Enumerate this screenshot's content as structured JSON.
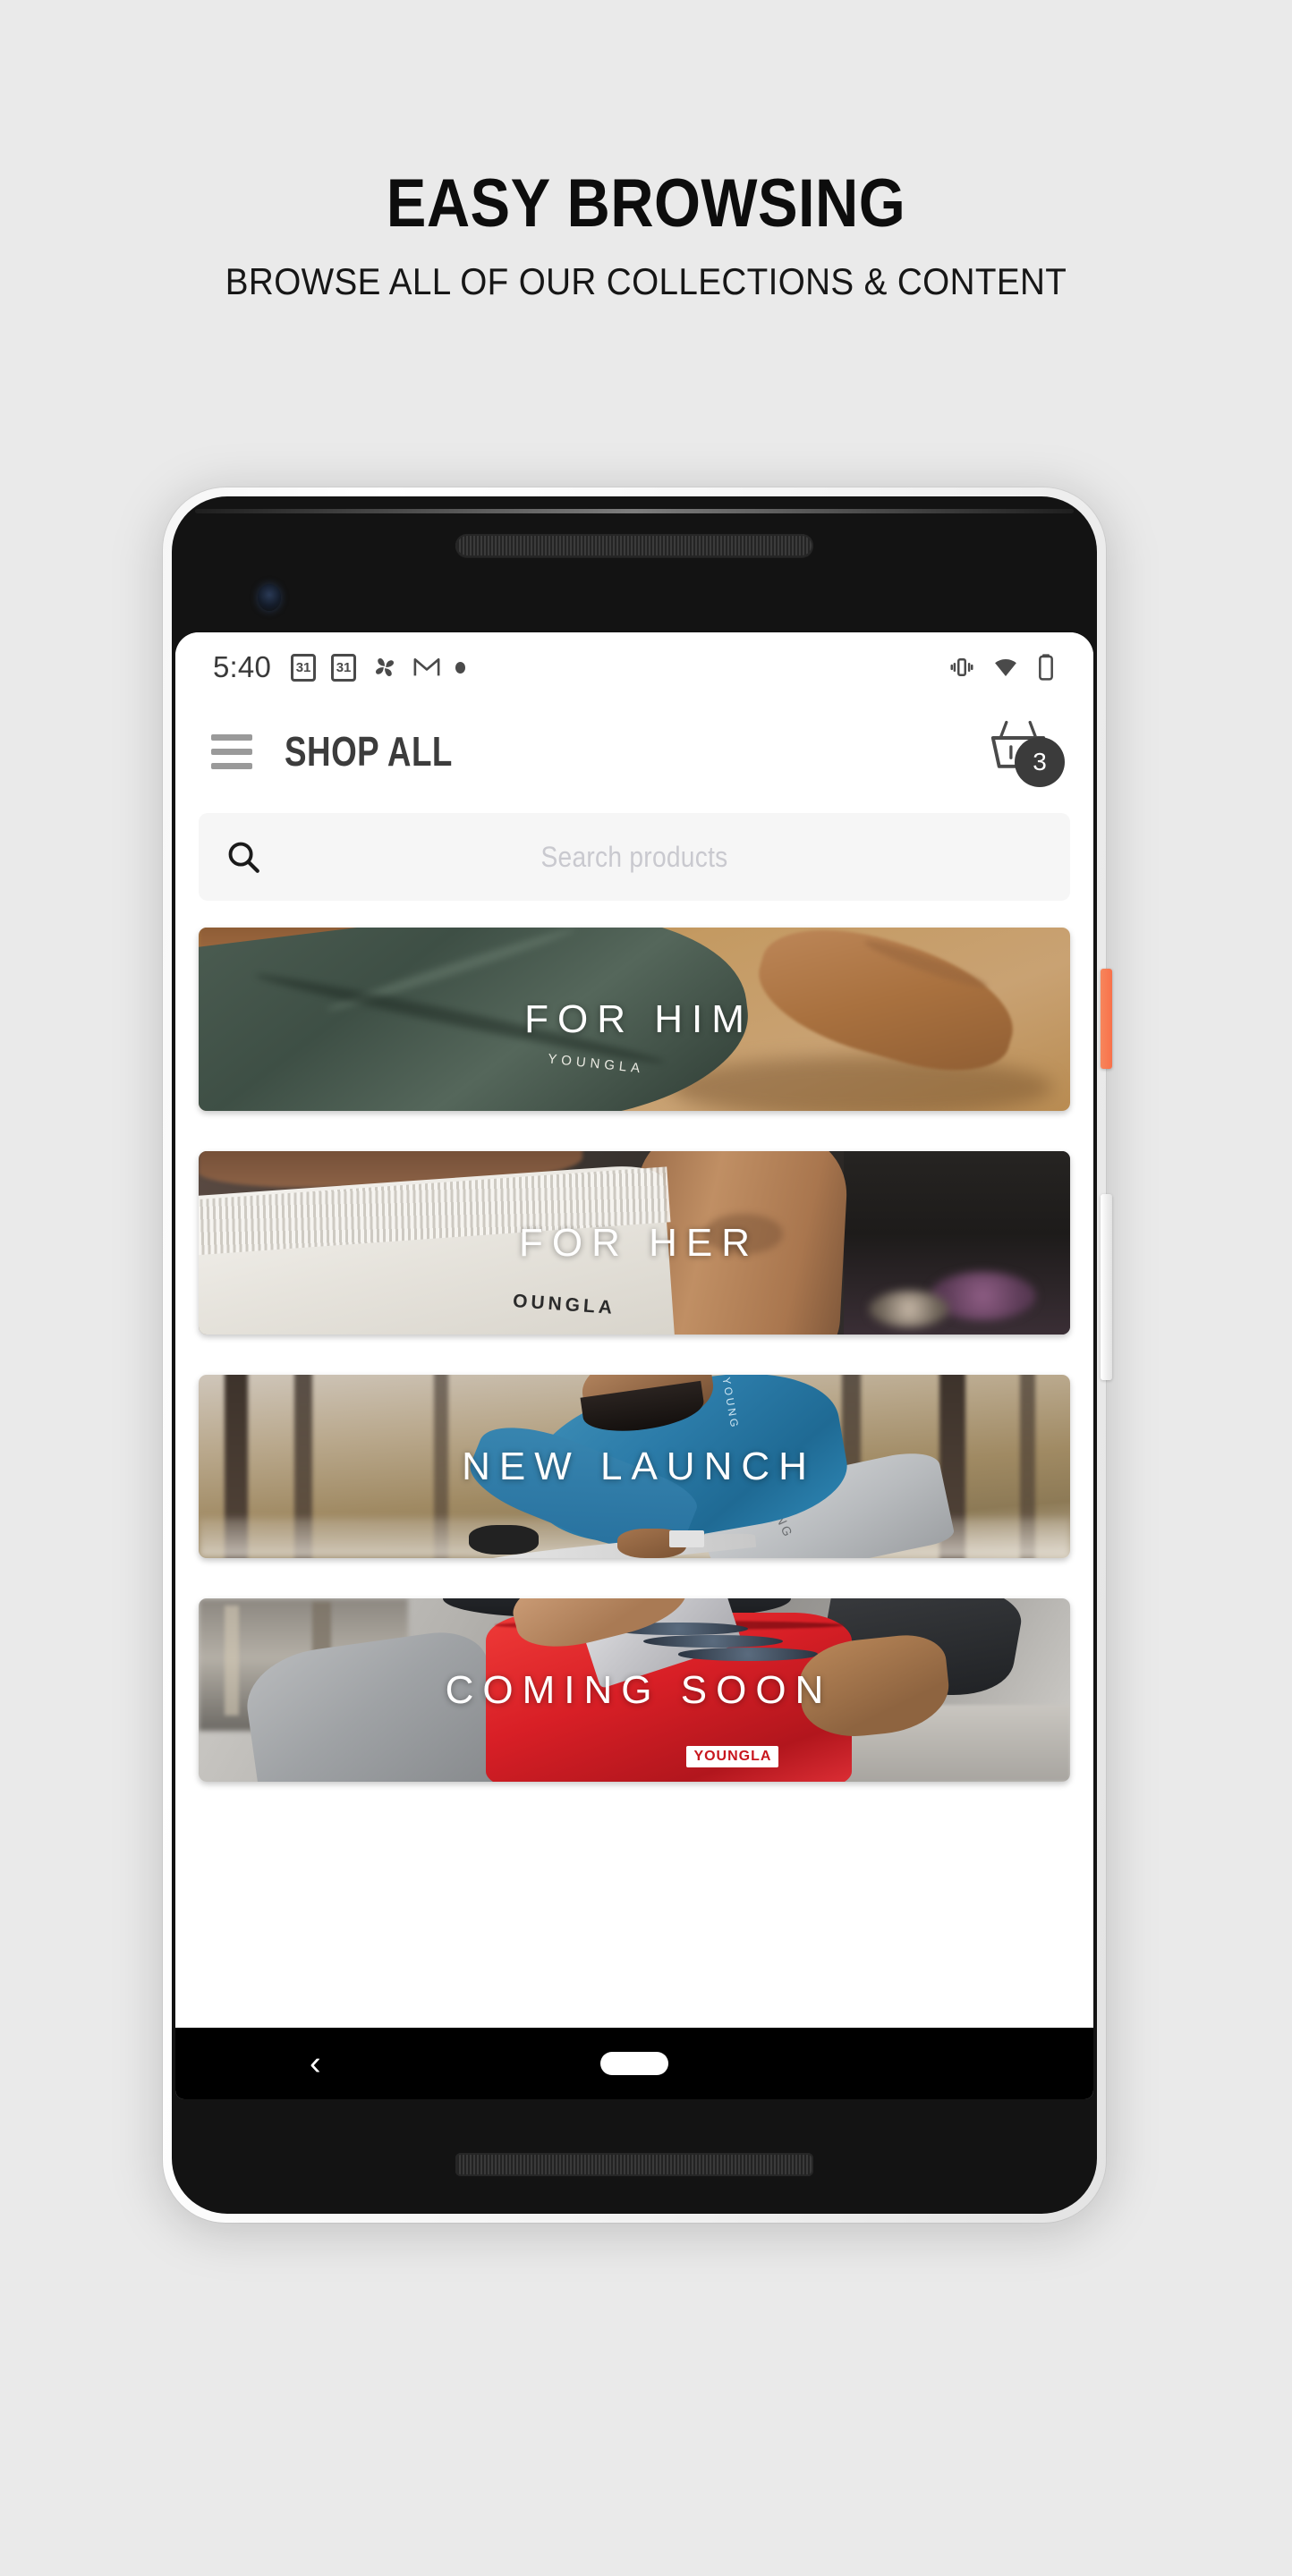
{
  "promo": {
    "title": "EASY BROWSING",
    "subtitle": "BROWSE ALL OF OUR COLLECTIONS & CONTENT"
  },
  "statusbar": {
    "time": "5:40",
    "icons_left": [
      "calendar-icon",
      "calendar-icon",
      "photos-pinwheel-icon",
      "gmail-icon",
      "dot-icon"
    ],
    "calendar_day": "31",
    "gmail_glyph": "M",
    "icons_right": [
      "vibrate-icon",
      "wifi-icon",
      "battery-icon"
    ]
  },
  "appbar": {
    "menu_icon": "hamburger-menu-icon",
    "title": "SHOP ALL",
    "cart_icon": "shopping-basket-icon",
    "cart_count": "3"
  },
  "search": {
    "icon": "search-icon",
    "placeholder": "Search products",
    "value": ""
  },
  "cards": [
    {
      "label": "FOR HIM",
      "brand": "YOUNGLA"
    },
    {
      "label": "FOR HER",
      "brand": "OUNGLA"
    },
    {
      "label": "NEW LAUNCH",
      "brand": "YOUNG"
    },
    {
      "label": "COMING SOON",
      "brand": "YOUNGLA"
    }
  ],
  "navbar": {
    "back_glyph": "‹",
    "home_indicator": "home-pill"
  },
  "colors": {
    "page_background": "#eaeaea",
    "screen_background": "#ffffff",
    "appbar_title": "#3c3c3c",
    "badge_background": "#3b3b3b",
    "search_background": "#f6f6f6",
    "placeholder": "#c9c9cf",
    "power_button": "#f8714a",
    "navbar": "#000000"
  }
}
